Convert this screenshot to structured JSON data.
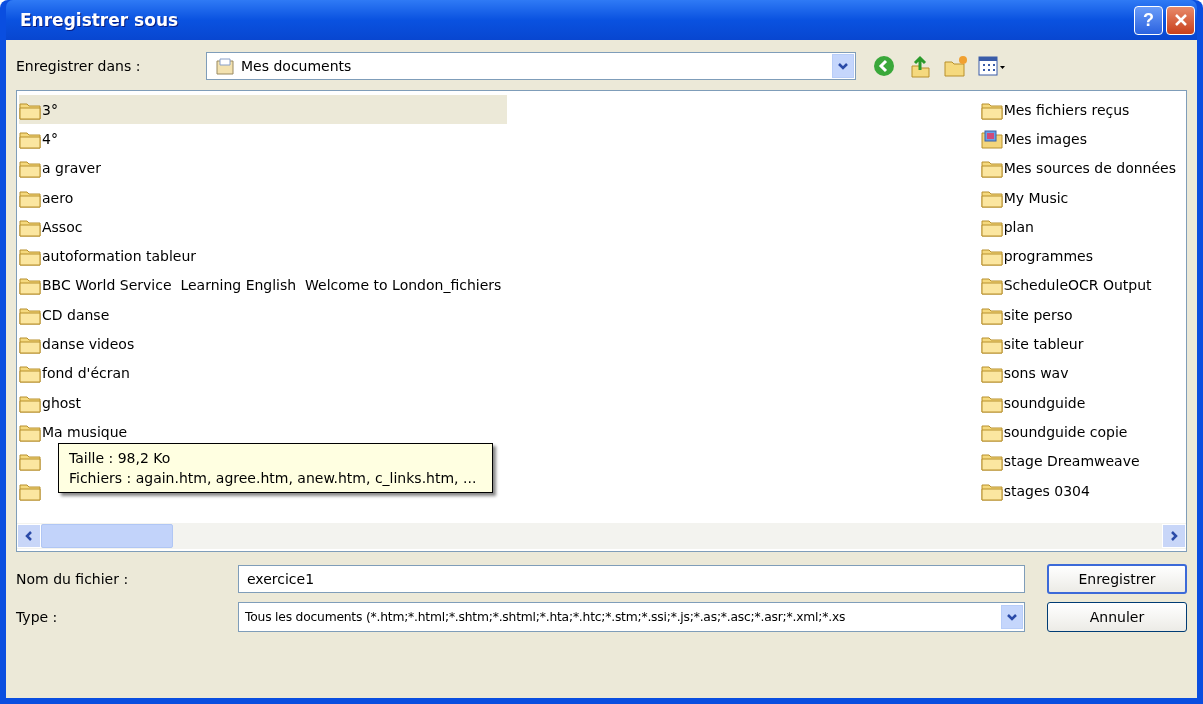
{
  "window": {
    "title": "Enregistrer sous",
    "buttons": [
      {
        "kind": "help",
        "label": "?"
      },
      {
        "kind": "close"
      }
    ]
  },
  "location": {
    "label": "Enregistrer dans :",
    "value": "Mes documents"
  },
  "toolbar": [
    {
      "kind": "back"
    },
    {
      "kind": "up"
    },
    {
      "kind": "new-folder"
    },
    {
      "kind": "views"
    }
  ],
  "columns": [
    [
      {
        "kind": "folder",
        "label": "3°",
        "selected": true
      },
      {
        "kind": "folder",
        "label": "4°",
        "selected": false
      },
      {
        "kind": "folder",
        "label": "a graver",
        "selected": false
      },
      {
        "kind": "folder",
        "label": "aero",
        "selected": false
      },
      {
        "kind": "folder",
        "label": "Assoc",
        "selected": false
      },
      {
        "kind": "folder",
        "label": "autoformation tableur",
        "selected": false
      },
      {
        "kind": "folder",
        "label": "BBC World Service  Learning English  Welcome to London_fichiers",
        "selected": false
      },
      {
        "kind": "folder",
        "label": "CD danse",
        "selected": false
      },
      {
        "kind": "folder",
        "label": "danse videos",
        "selected": false
      },
      {
        "kind": "folder",
        "label": "fond d'écran",
        "selected": false
      },
      {
        "kind": "folder",
        "label": "ghost",
        "selected": false
      },
      {
        "kind": "folder",
        "label": "Ma musique",
        "selected": false
      },
      {
        "kind": "folder",
        "selected": false
      },
      {
        "kind": "folder",
        "selected": false
      }
    ],
    [
      {
        "kind": "folder",
        "label": "Mes fichiers reçus",
        "selected": false
      },
      {
        "kind": "pictures",
        "label": "Mes images",
        "selected": false
      },
      {
        "kind": "folder",
        "label": "Mes sources de données",
        "selected": false
      },
      {
        "kind": "folder",
        "label": "My Music",
        "selected": false
      },
      {
        "kind": "folder",
        "label": "plan",
        "selected": false
      },
      {
        "kind": "folder",
        "label": "programmes",
        "selected": false
      },
      {
        "kind": "folder",
        "label": "ScheduleOCR Output",
        "selected": false
      },
      {
        "kind": "folder",
        "label": "site perso",
        "selected": false
      },
      {
        "kind": "folder",
        "label": "site tableur",
        "selected": false
      },
      {
        "kind": "folder",
        "label": "sons wav",
        "selected": false
      },
      {
        "kind": "folder",
        "label": "soundguide",
        "selected": false
      },
      {
        "kind": "folder",
        "label": "soundguide copie",
        "selected": false
      },
      {
        "kind": "folder",
        "label": "stage Dreamweave",
        "selected": false
      },
      {
        "kind": "folder",
        "label": "stages 0304",
        "selected": false
      }
    ]
  ],
  "tooltip": {
    "lines": [
      "Taille : 98,2 Ko",
      "Fichiers : again.htm, agree.htm, anew.htm, c_links.htm, ..."
    ]
  },
  "filename": {
    "label": "Nom du fichier :",
    "value": "exercice1"
  },
  "type": {
    "label": "Type :",
    "value": "Tous les documents (*.htm;*.html;*.shtm;*.shtml;*.hta;*.htc;*.stm;*.ssi;*.js;*.as;*.asc;*.asr;*.xml;*.xs"
  },
  "buttons": [
    {
      "label": "Enregistrer",
      "default": true
    },
    {
      "label": "Annuler",
      "default": false
    }
  ]
}
